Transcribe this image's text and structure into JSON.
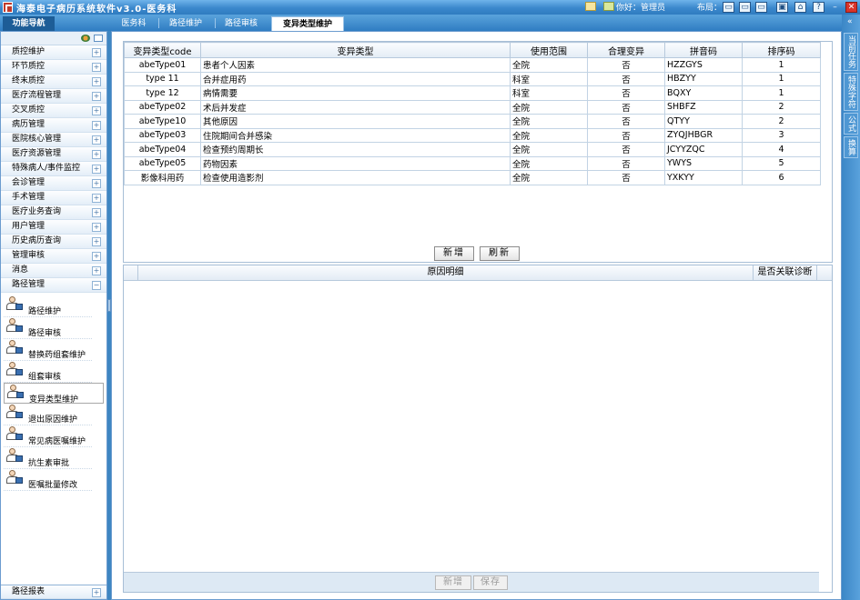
{
  "app": {
    "title": "海泰电子病历系统软件v3.0-医务科",
    "user_greeting": "你好：管理员",
    "layout_label": "布局："
  },
  "nav": {
    "title": "功能导航",
    "menu": [
      "质控维护",
      "环节质控",
      "终末质控",
      "医疗流程管理",
      "交叉质控",
      "病历管理",
      "医院核心管理",
      "医疗资源管理",
      "特殊病人/事件监控",
      "会诊管理",
      "手术管理",
      "医疗业务查询",
      "用户管理",
      "历史病历查询",
      "管理审核",
      "消息",
      "路径管理"
    ],
    "expanded_menu": "路径管理",
    "subitems": [
      "路径维护",
      "路径审核",
      "替换药组套维护",
      "组套审核",
      "变异类型维护",
      "退出原因维护",
      "常见病医嘱维护",
      "抗生素审批",
      "医嘱批量修改"
    ],
    "selected_subitem": "变异类型维护",
    "bottom_menu": "路径报表"
  },
  "tabs": [
    "医务科",
    "路径维护",
    "路径审核",
    "变异类型维护"
  ],
  "active_tab": "变异类型维护",
  "right_tabs": [
    "当前任务",
    "特殊字符",
    "公式",
    "换算"
  ],
  "grid": {
    "columns": [
      "变异类型code",
      "变异类型",
      "使用范围",
      "合理变异",
      "拼音码",
      "排序码"
    ],
    "rows": [
      [
        "abeType01",
        "患者个人因素",
        "全院",
        "否",
        "HZZGYS",
        "1"
      ],
      [
        "type 11",
        "合并症用药",
        "科室",
        "否",
        "HBZYY",
        "1"
      ],
      [
        "type 12",
        "病情需要",
        "科室",
        "否",
        "BQXY",
        "1"
      ],
      [
        "abeType02",
        "术后并发症",
        "全院",
        "否",
        "SHBFZ",
        "2"
      ],
      [
        "abeType10",
        "其他原因",
        "全院",
        "否",
        "QTYY",
        "2"
      ],
      [
        "abeType03",
        "住院期间合并感染",
        "全院",
        "否",
        "ZYQJHBGR",
        "3"
      ],
      [
        "abeType04",
        "检查预约周期长",
        "全院",
        "否",
        "JCYYZQC",
        "4"
      ],
      [
        "abeType05",
        "药物因素",
        "全院",
        "否",
        "YWYS",
        "5"
      ],
      [
        "影像科用药",
        "检查使用造影剂",
        "全院",
        "否",
        "YXKYY",
        "6"
      ]
    ]
  },
  "buttons": {
    "add": "新增",
    "refresh": "刷新",
    "add_detail": "新增",
    "save_detail": "保存"
  },
  "detail": {
    "columns": [
      "原因明细",
      "是否关联诊断"
    ]
  },
  "colors": {
    "chrome_blue": "#3e86c2",
    "nav_title_bg": "#1d5d97",
    "close_red": "#d9342b"
  }
}
